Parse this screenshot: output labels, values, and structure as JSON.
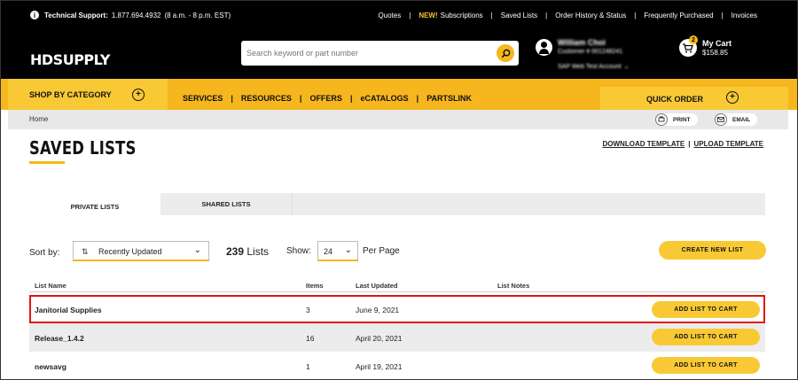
{
  "topbar": {
    "support_label": "Technical Support:",
    "support_phone": "1.877.694.4932",
    "support_hours": "(8 a.m. - 8 p.m. EST)",
    "links": {
      "quotes": "Quotes",
      "new_badge": "NEW!",
      "subscriptions": "Subscriptions",
      "saved_lists": "Saved Lists",
      "order_history": "Order History & Status",
      "frequently_purchased": "Frequently Purchased",
      "invoices": "Invoices"
    },
    "separator": "|"
  },
  "header": {
    "logo": "HDSUPPLY",
    "search_placeholder": "Search keyword or part number",
    "user_name": "William Choi",
    "customer_number": "Customer # 001248241",
    "account": "SAP Web Test Account",
    "cart_label": "My Cart",
    "cart_total": "$158.85",
    "cart_count": "2"
  },
  "nav": {
    "shop_by_category": "SHOP BY CATEGORY",
    "links": [
      "SERVICES",
      "RESOURCES",
      "OFFERS",
      "eCATALOGS",
      "PARTSLINK"
    ],
    "separator": "|",
    "quick_order": "QUICK ORDER",
    "plus": "+"
  },
  "breadcrumb": {
    "home": "Home",
    "print": "PRINT",
    "email": "EMAIL"
  },
  "page": {
    "title": "SAVED LISTS",
    "download_template": "DOWNLOAD TEMPLATE",
    "upload_template": "UPLOAD TEMPLATE",
    "template_separator": "|"
  },
  "tabs": {
    "private": "PRIVATE LISTS",
    "shared": "SHARED LISTS"
  },
  "controls": {
    "sort_label": "Sort by:",
    "sort_value": "Recently Updated",
    "list_count": "239",
    "list_count_suffix": "Lists",
    "show_label": "Show:",
    "show_value": "24",
    "per_page": "Per Page",
    "create_button": "CREATE NEW LIST"
  },
  "table": {
    "headers": {
      "name": "List Name",
      "items": "Items",
      "updated": "Last Updated",
      "notes": "List Notes"
    },
    "rows": [
      {
        "name": "Janitorial Supplies",
        "items": "3",
        "updated": "June 9, 2021",
        "action": "ADD LIST TO CART"
      },
      {
        "name": "Release_1.4.2",
        "items": "16",
        "updated": "April 20, 2021",
        "action": "ADD LIST TO CART"
      },
      {
        "name": "newsavg",
        "items": "1",
        "updated": "April 19, 2021",
        "action": "ADD LIST TO CART"
      }
    ]
  },
  "colors": {
    "brand_yellow": "#f6b61e",
    "brand_black": "#000000",
    "highlight_red": "#e01515"
  }
}
